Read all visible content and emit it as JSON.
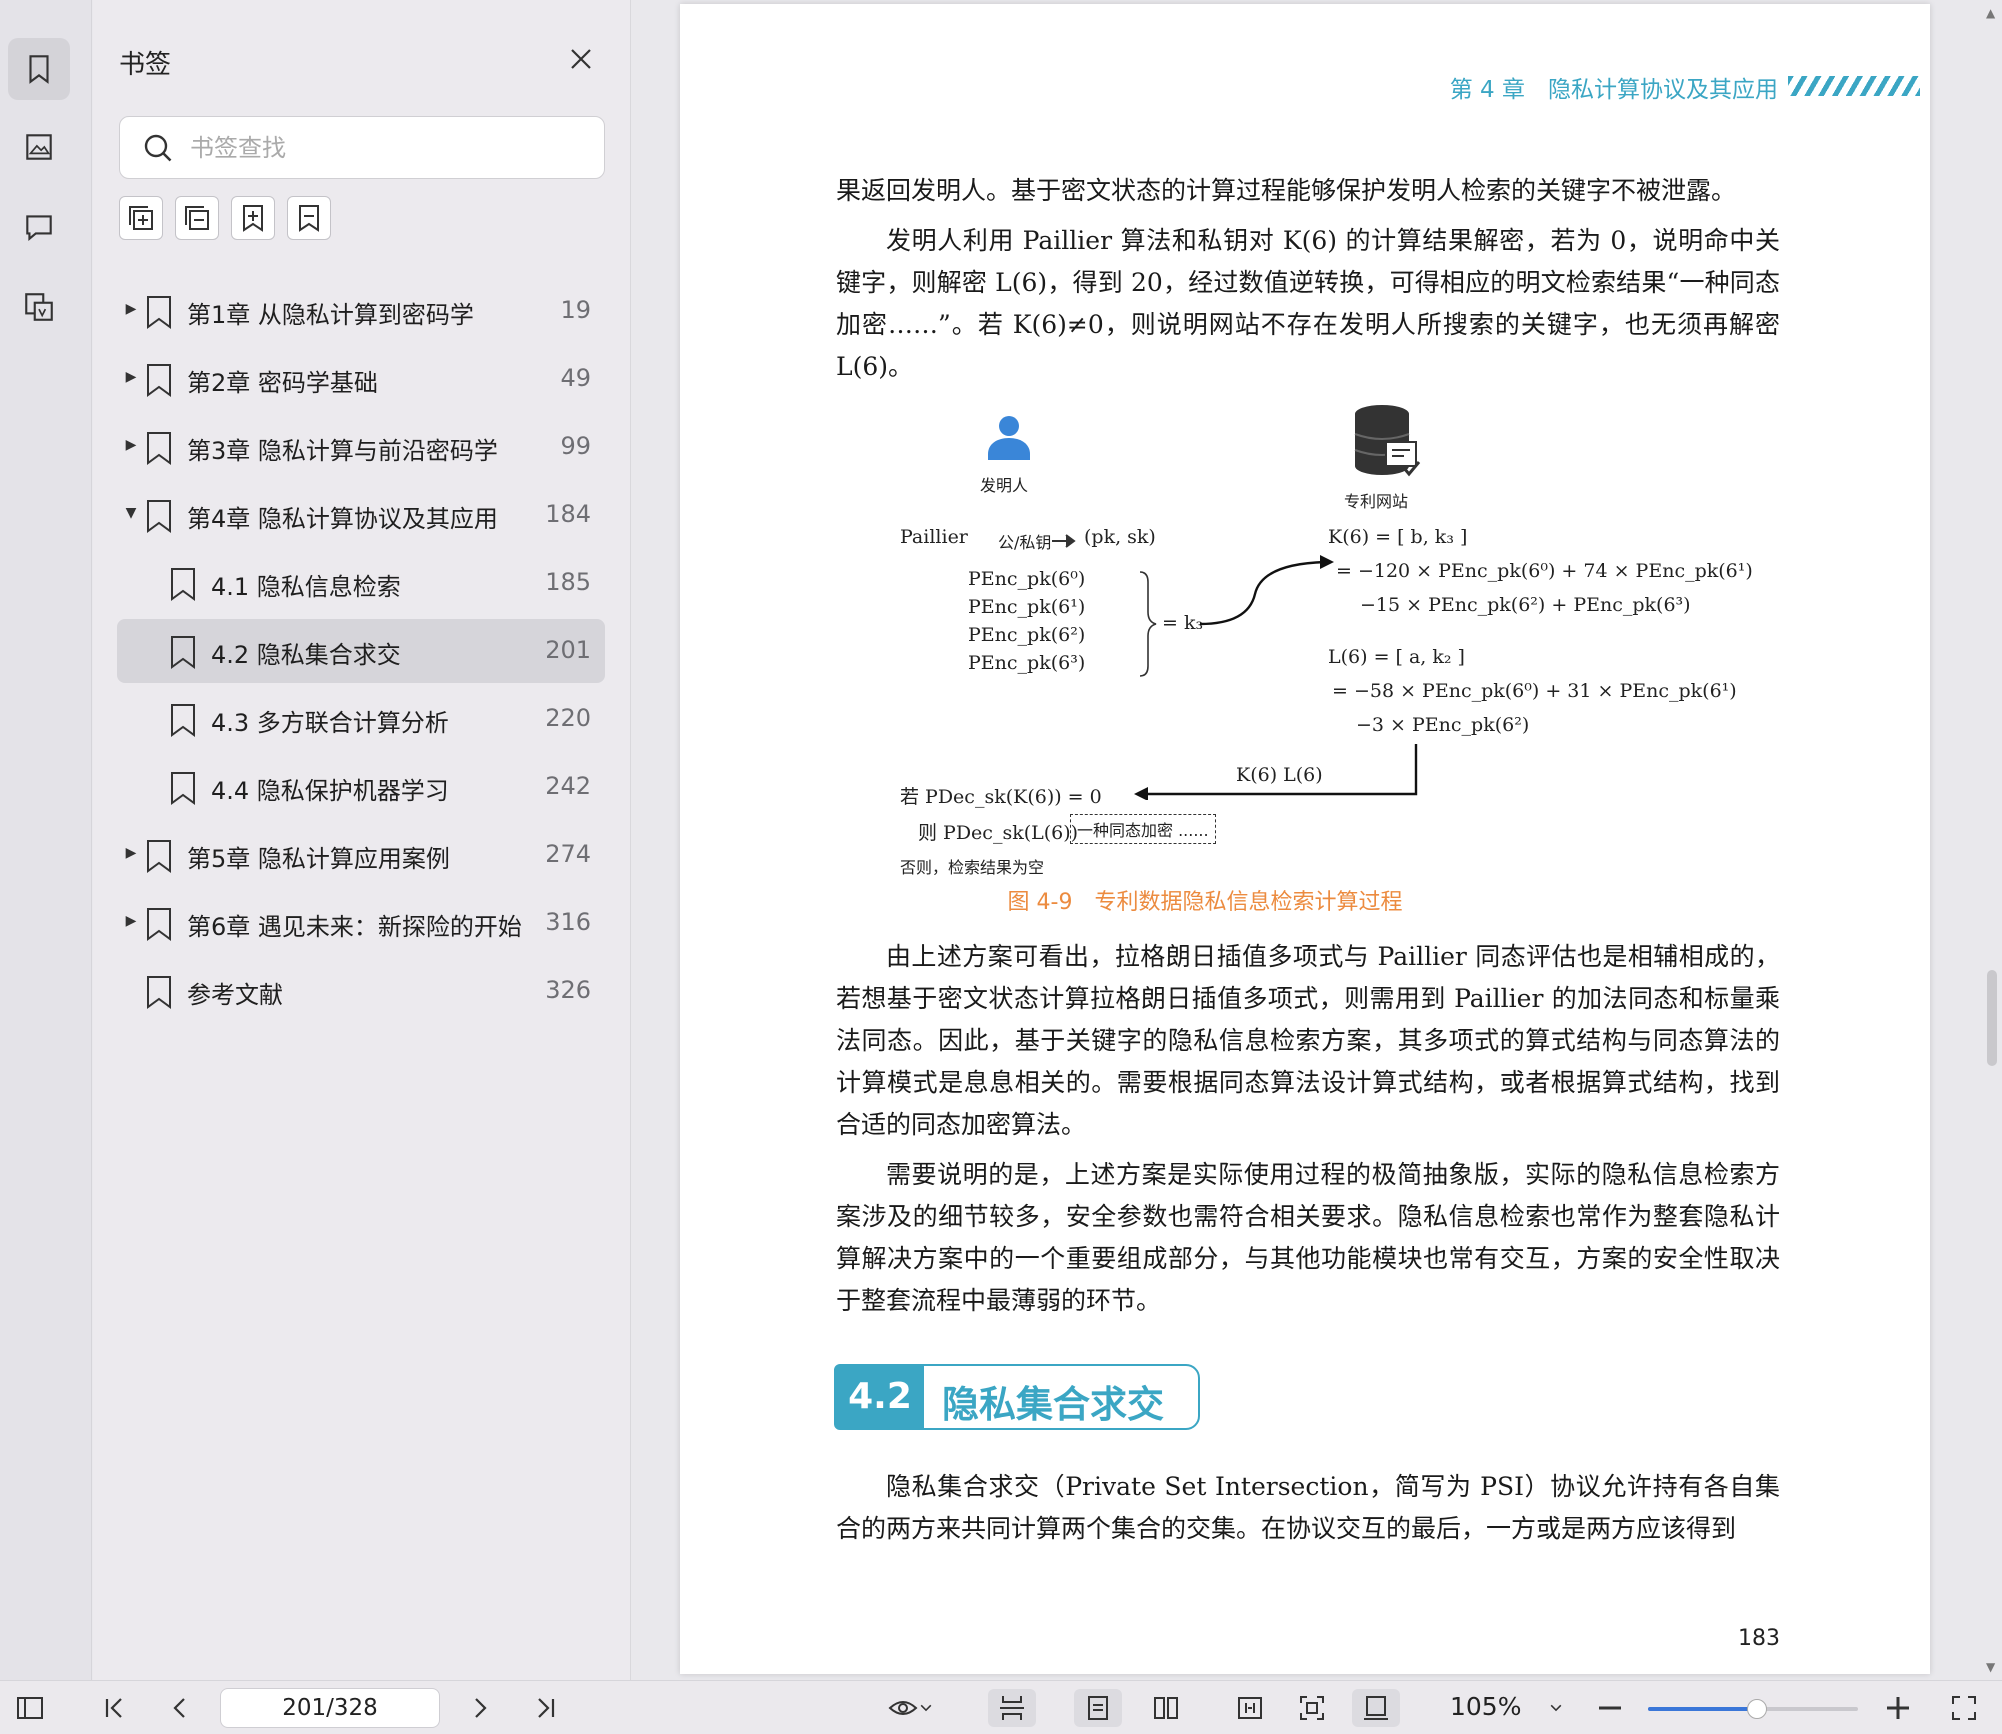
{
  "panel": {
    "title": "书签",
    "search_placeholder": "书签查找",
    "bookmarks": [
      {
        "label": "第1章 从隐私计算到密码学",
        "page": "19",
        "level": 0,
        "expand": "collapsed"
      },
      {
        "label": "第2章 密码学基础",
        "page": "49",
        "level": 0,
        "expand": "collapsed"
      },
      {
        "label": "第3章 隐私计算与前沿密码学",
        "page": "99",
        "level": 0,
        "expand": "collapsed"
      },
      {
        "label": "第4章 隐私计算协议及其应用",
        "page": "184",
        "level": 0,
        "expand": "expanded"
      },
      {
        "label": "4.1 隐私信息检索",
        "page": "185",
        "level": 1,
        "expand": "none"
      },
      {
        "label": "4.2 隐私集合求交",
        "page": "201",
        "level": 1,
        "expand": "none",
        "selected": true
      },
      {
        "label": "4.3 多方联合计算分析",
        "page": "220",
        "level": 1,
        "expand": "none"
      },
      {
        "label": "4.4 隐私保护机器学习",
        "page": "242",
        "level": 1,
        "expand": "none"
      },
      {
        "label": "第5章 隐私计算应用案例",
        "page": "274",
        "level": 0,
        "expand": "collapsed"
      },
      {
        "label": "第6章 遇见未来：新探险的开始",
        "page": "316",
        "level": 0,
        "expand": "collapsed"
      },
      {
        "label": "参考文献",
        "page": "326",
        "level": 0,
        "expand": "none"
      }
    ]
  },
  "document": {
    "running_head": "第 4 章　隐私计算协议及其应用",
    "para1": "果返回发明人。基于密文状态的计算过程能够保护发明人检索的关键字不被泄露。",
    "para2": "发明人利用 Paillier 算法和私钥对 K(6) 的计算结果解密，若为 0，说明命中关键字，则解密 L(6)，得到 20，经过数值逆转换，可得相应的明文检索结果“一种同态加密……”。若 K(6)≠0，则说明网站不存在发明人所搜索的关键字，也无须再解密 L(6)。",
    "figure": {
      "inventor_label": "发明人",
      "website_label": "专利网站",
      "paillier": "Paillier",
      "keygen_arrow": "公/私钥",
      "pk_sk": "(pk, sk)",
      "penc_list": [
        "PEnc_pk(6⁰)",
        "PEnc_pk(6¹)",
        "PEnc_pk(6²)",
        "PEnc_pk(6³)"
      ],
      "eq_k3": "= k₃",
      "k6_line1": "K(6) = [ b, k₃ ]",
      "k6_line2": "= −120 × PEnc_pk(6⁰) + 74 × PEnc_pk(6¹)",
      "k6_line3": "−15 × PEnc_pk(6²) + PEnc_pk(6³)",
      "l6_line1": "L(6) = [ a, k₂ ]",
      "l6_line2": "= −58 × PEnc_pk(6⁰) + 31 × PEnc_pk(6¹)",
      "l6_line3": "−3 × PEnc_pk(6²)",
      "return_label": "K(6)   L(6)",
      "if_line": "若  PDec_sk(K(6)) = 0",
      "then_line": "则  PDec_sk(L(6))",
      "result_box": "一种同态加密 ......",
      "else_line": "否则，检索结果为空"
    },
    "figure_caption": "图 4-9　专利数据隐私信息检索计算过程",
    "para3": "由上述方案可看出，拉格朗日插值多项式与 Paillier 同态评估也是相辅相成的，若想基于密文状态计算拉格朗日插值多项式，则需用到 Paillier 的加法同态和标量乘法同态。因此，基于关键字的隐私信息检索方案，其多项式的算式结构与同态算法的计算模式是息息相关的。需要根据同态算法设计算式结构，或者根据算式结构，找到合适的同态加密算法。",
    "para4": "需要说明的是，上述方案是实际使用过程的极简抽象版，实际的隐私信息检索方案涉及的细节较多，安全参数也需符合相关要求。隐私信息检索也常作为整套隐私计算解决方案中的一个重要组成部分，与其他功能模块也常有交互，方案的安全性取决于整套流程中最薄弱的环节。",
    "section_number": "4.2",
    "section_title": "隐私集合求交",
    "para5": "隐私集合求交（Private Set Intersection，简写为 PSI）协议允许持有各自集合的两方来共同计算两个集合的交集。在协议交互的最后，一方或是两方应该得到",
    "page_number": "183"
  },
  "toolbar": {
    "page_indicator": "201/328",
    "zoom": "105%",
    "zoom_slider_fraction": 0.52
  },
  "colors": {
    "accent": "#3ba6c4",
    "caption": "#ec8b3f",
    "slider": "#3a76d8"
  }
}
